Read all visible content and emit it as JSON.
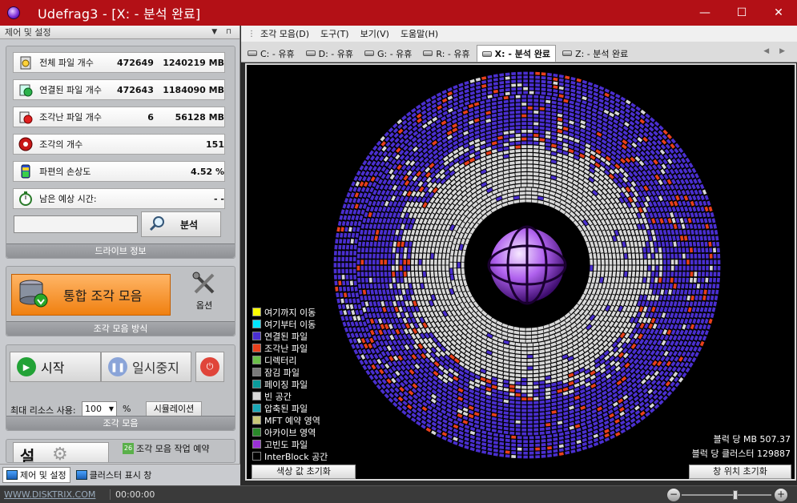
{
  "window": {
    "title": "Udefrag3 - [X: - 분석 완료]"
  },
  "left_panel": {
    "header": "제어 및 설정",
    "stats": [
      {
        "label": "전체 파일 개수",
        "v1": "472649",
        "v2": "1240219 MB",
        "icon": "files-icon"
      },
      {
        "label": "연결된 파일 개수",
        "v1": "472643",
        "v2": "1184090 MB",
        "icon": "contiguous-files-icon"
      },
      {
        "label": "조각난 파일 개수",
        "v1": "6",
        "v2": "56128 MB",
        "icon": "fragmented-files-icon"
      },
      {
        "label": "조각의 개수",
        "v1": "",
        "v2": "151",
        "icon": "fragments-icon"
      },
      {
        "label": "파편의 손상도",
        "v1": "",
        "v2": "4.52 %",
        "icon": "fragmentation-level-icon"
      },
      {
        "label": "남은 예상 시간:",
        "v1": "",
        "v2": "- -",
        "icon": "stopwatch-icon"
      }
    ],
    "path_value": "",
    "analyze_label": "분석",
    "drive_info_caption": "드라이브 정보",
    "defrag_label": "통합 조각 모음",
    "options_label": "옵션",
    "mode_caption": "조각 모음 방식",
    "start_label": "시작",
    "pause_label": "일시중지",
    "resource_label": "최대 리소스 사용:",
    "resource_value": "100",
    "resource_unit": "%",
    "simulation_label": "시뮬레이션",
    "defrag_caption": "조각 모음",
    "schedule_label": "조각 모음 작업 예약",
    "settings_glyph": "설",
    "tabs": [
      "제어 및 설정",
      "클러스터 표시 창"
    ]
  },
  "menu": [
    "조각 모음(D)",
    "도구(T)",
    "보기(V)",
    "도움말(H)"
  ],
  "drive_tabs": [
    "C: - 유휴",
    "D: - 유휴",
    "G: - 유휴",
    "R: - 유휴",
    "X: - 분석 완료",
    "Z: - 분석 완료"
  ],
  "active_tab": 4,
  "legend": [
    {
      "label": "여기까지 이동",
      "color": "#ffff00"
    },
    {
      "label": "여기부터 이동",
      "color": "#00e5ff"
    },
    {
      "label": "연결된 파일",
      "color": "#4a2fd0"
    },
    {
      "label": "조각난 파일",
      "color": "#e8401c"
    },
    {
      "label": "디렉터리",
      "color": "#6cbf4a"
    },
    {
      "label": "잠김 파일",
      "color": "#7a7a7a"
    },
    {
      "label": "페이징 파일",
      "color": "#0a9a9a"
    },
    {
      "label": "빈 공간",
      "color": "#d8d8d8"
    },
    {
      "label": "압축된 파일",
      "color": "#1aa8b8"
    },
    {
      "label": "MFT 예약 영역",
      "color": "#c8c878"
    },
    {
      "label": "아카이브 영역",
      "color": "#2a8a2a"
    },
    {
      "label": "고빈도 파일",
      "color": "#9a30d8"
    },
    {
      "label": "InterBlock 공간",
      "color": "#000000"
    }
  ],
  "map_info": {
    "mb_per_block": "블럭 당 MB 507.37",
    "clusters_per_block": "블럭 당 클러스터 129887"
  },
  "buttons": {
    "reset_colors": "색상 값 초기화",
    "reset_window": "창 위치 초기화"
  },
  "status": {
    "url": "WWW.DISKTRIX.COM",
    "time": "00:00:00"
  },
  "zoom_level": 0.6
}
